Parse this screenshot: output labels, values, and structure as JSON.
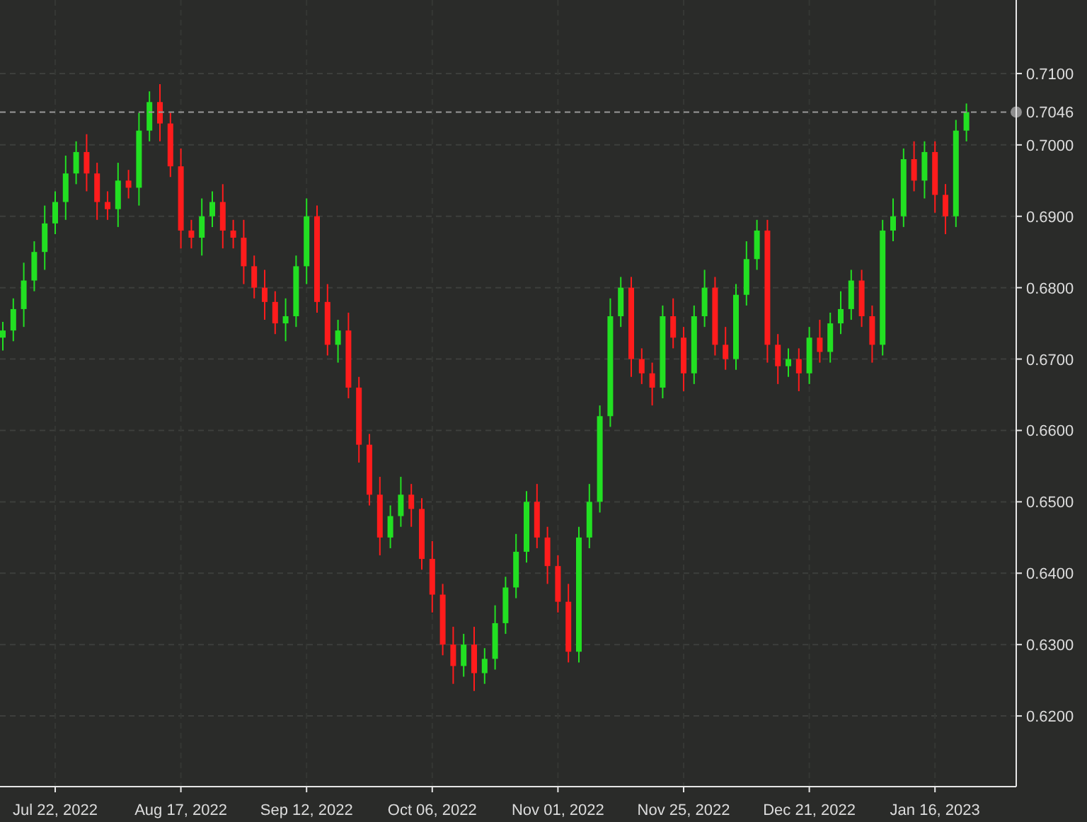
{
  "chart": {
    "chart_data": {
      "type": "candlestick",
      "grid": true,
      "ref_lines": [
        {
          "axis": "y",
          "value": 0.7046,
          "label": "0.7046"
        }
      ],
      "categories": [
        null,
        null,
        null,
        null,
        null,
        "Jul 22, 2022",
        null,
        null,
        null,
        null,
        null,
        null,
        null,
        null,
        null,
        null,
        null,
        "Aug 17, 2022",
        null,
        null,
        null,
        null,
        null,
        null,
        null,
        null,
        null,
        null,
        null,
        "Sep 12, 2022",
        null,
        null,
        null,
        null,
        null,
        null,
        null,
        null,
        null,
        null,
        null,
        "Oct 06, 2022",
        null,
        null,
        null,
        null,
        null,
        null,
        null,
        null,
        null,
        null,
        null,
        "Nov 01, 2022",
        null,
        null,
        null,
        null,
        null,
        null,
        null,
        null,
        null,
        null,
        null,
        "Nov 25, 2022",
        null,
        null,
        null,
        null,
        null,
        null,
        null,
        null,
        null,
        null,
        null,
        "Dec 21, 2022",
        null,
        null,
        null,
        null,
        null,
        null,
        null,
        null,
        null,
        null,
        null,
        "Jan 16, 2023",
        null,
        null,
        null
      ],
      "ohlc": [
        [
          0.673,
          0.6752,
          0.6712,
          0.674
        ],
        [
          0.674,
          0.6785,
          0.6725,
          0.677
        ],
        [
          0.677,
          0.6835,
          0.6745,
          0.681
        ],
        [
          0.681,
          0.6865,
          0.6795,
          0.685
        ],
        [
          0.685,
          0.6915,
          0.6825,
          0.689
        ],
        [
          0.689,
          0.6935,
          0.6875,
          0.692
        ],
        [
          0.692,
          0.6985,
          0.6895,
          0.696
        ],
        [
          0.696,
          0.7005,
          0.6945,
          0.699
        ],
        [
          0.699,
          0.7015,
          0.6935,
          0.696
        ],
        [
          0.696,
          0.6975,
          0.6895,
          0.692
        ],
        [
          0.692,
          0.6935,
          0.6895,
          0.691
        ],
        [
          0.691,
          0.6975,
          0.6885,
          0.695
        ],
        [
          0.695,
          0.6965,
          0.6925,
          0.694
        ],
        [
          0.694,
          0.7045,
          0.6915,
          0.702
        ],
        [
          0.702,
          0.7075,
          0.7005,
          0.706
        ],
        [
          0.706,
          0.7085,
          0.7005,
          0.703
        ],
        [
          0.703,
          0.7045,
          0.6955,
          0.697
        ],
        [
          0.697,
          0.6995,
          0.6855,
          0.688
        ],
        [
          0.688,
          0.6895,
          0.6855,
          0.687
        ],
        [
          0.687,
          0.6925,
          0.6845,
          0.69
        ],
        [
          0.69,
          0.6935,
          0.6885,
          0.692
        ],
        [
          0.692,
          0.6945,
          0.6855,
          0.688
        ],
        [
          0.688,
          0.6895,
          0.6855,
          0.687
        ],
        [
          0.687,
          0.6895,
          0.6805,
          0.683
        ],
        [
          0.683,
          0.6845,
          0.6785,
          0.68
        ],
        [
          0.68,
          0.6825,
          0.6755,
          0.678
        ],
        [
          0.678,
          0.6795,
          0.6735,
          0.675
        ],
        [
          0.675,
          0.6785,
          0.6725,
          0.676
        ],
        [
          0.676,
          0.6845,
          0.6745,
          0.683
        ],
        [
          0.683,
          0.6925,
          0.6805,
          0.69
        ],
        [
          0.69,
          0.6915,
          0.6765,
          0.678
        ],
        [
          0.678,
          0.6805,
          0.6705,
          0.672
        ],
        [
          0.672,
          0.6755,
          0.6695,
          0.674
        ],
        [
          0.674,
          0.6765,
          0.6645,
          0.666
        ],
        [
          0.666,
          0.6675,
          0.6555,
          0.658
        ],
        [
          0.658,
          0.6595,
          0.6495,
          0.651
        ],
        [
          0.651,
          0.6535,
          0.6425,
          0.645
        ],
        [
          0.645,
          0.6495,
          0.6435,
          0.648
        ],
        [
          0.648,
          0.6535,
          0.6465,
          0.651
        ],
        [
          0.651,
          0.6525,
          0.6465,
          0.649
        ],
        [
          0.649,
          0.6505,
          0.6405,
          0.642
        ],
        [
          0.642,
          0.6445,
          0.6345,
          0.637
        ],
        [
          0.637,
          0.6385,
          0.6285,
          0.63
        ],
        [
          0.63,
          0.6325,
          0.6245,
          0.627
        ],
        [
          0.627,
          0.6315,
          0.6255,
          0.63
        ],
        [
          0.63,
          0.6325,
          0.6235,
          0.626
        ],
        [
          0.626,
          0.6295,
          0.6245,
          0.628
        ],
        [
          0.628,
          0.6355,
          0.6265,
          0.633
        ],
        [
          0.633,
          0.6395,
          0.6315,
          0.638
        ],
        [
          0.638,
          0.6455,
          0.6365,
          0.643
        ],
        [
          0.643,
          0.6515,
          0.6415,
          0.65
        ],
        [
          0.65,
          0.6525,
          0.6435,
          0.645
        ],
        [
          0.645,
          0.6465,
          0.6385,
          0.641
        ],
        [
          0.641,
          0.6425,
          0.6345,
          0.636
        ],
        [
          0.636,
          0.6385,
          0.6275,
          0.629
        ],
        [
          0.629,
          0.6465,
          0.6275,
          0.645
        ],
        [
          0.645,
          0.6525,
          0.6435,
          0.65
        ],
        [
          0.65,
          0.6635,
          0.6485,
          0.662
        ],
        [
          0.662,
          0.6785,
          0.6605,
          0.676
        ],
        [
          0.676,
          0.6815,
          0.6745,
          0.68
        ],
        [
          0.68,
          0.6815,
          0.6675,
          0.67
        ],
        [
          0.67,
          0.6715,
          0.6665,
          0.668
        ],
        [
          0.668,
          0.6695,
          0.6635,
          0.666
        ],
        [
          0.666,
          0.6775,
          0.6645,
          0.676
        ],
        [
          0.676,
          0.6785,
          0.6715,
          0.673
        ],
        [
          0.673,
          0.6745,
          0.6655,
          0.668
        ],
        [
          0.668,
          0.6775,
          0.6665,
          0.676
        ],
        [
          0.676,
          0.6825,
          0.6745,
          0.68
        ],
        [
          0.68,
          0.6815,
          0.6705,
          0.672
        ],
        [
          0.672,
          0.6745,
          0.6685,
          0.67
        ],
        [
          0.67,
          0.6805,
          0.6685,
          0.679
        ],
        [
          0.679,
          0.6865,
          0.6775,
          0.684
        ],
        [
          0.684,
          0.6895,
          0.6825,
          0.688
        ],
        [
          0.688,
          0.6895,
          0.6695,
          0.672
        ],
        [
          0.672,
          0.6735,
          0.6665,
          0.669
        ],
        [
          0.669,
          0.6715,
          0.6675,
          0.67
        ],
        [
          0.67,
          0.6715,
          0.6655,
          0.668
        ],
        [
          0.668,
          0.6745,
          0.6665,
          0.673
        ],
        [
          0.673,
          0.6755,
          0.6695,
          0.671
        ],
        [
          0.671,
          0.6765,
          0.6695,
          0.675
        ],
        [
          0.675,
          0.6795,
          0.6735,
          0.677
        ],
        [
          0.677,
          0.6825,
          0.6755,
          0.681
        ],
        [
          0.681,
          0.6825,
          0.6745,
          0.676
        ],
        [
          0.676,
          0.6775,
          0.6695,
          0.672
        ],
        [
          0.672,
          0.6895,
          0.6705,
          0.688
        ],
        [
          0.688,
          0.6925,
          0.6865,
          0.69
        ],
        [
          0.69,
          0.6995,
          0.6885,
          0.698
        ],
        [
          0.698,
          0.7005,
          0.6935,
          0.695
        ],
        [
          0.695,
          0.7005,
          0.6925,
          0.699
        ],
        [
          0.699,
          0.7005,
          0.6905,
          0.693
        ],
        [
          0.693,
          0.6945,
          0.6875,
          0.69
        ],
        [
          0.69,
          0.7035,
          0.6885,
          0.702
        ],
        [
          0.702,
          0.7058,
          0.7005,
          0.7046
        ]
      ],
      "ylim": [
        0.6101,
        0.7203
      ],
      "yticks": [
        {
          "value": 0.71,
          "label": "0.7100"
        },
        {
          "value": 0.7,
          "label": "0.7000"
        },
        {
          "value": 0.69,
          "label": "0.6900"
        },
        {
          "value": 0.68,
          "label": "0.6800"
        },
        {
          "value": 0.67,
          "label": "0.6700"
        },
        {
          "value": 0.66,
          "label": "0.6600"
        },
        {
          "value": 0.65,
          "label": "0.6500"
        },
        {
          "value": 0.64,
          "label": "0.6400"
        },
        {
          "value": 0.63,
          "label": "0.6300"
        },
        {
          "value": 0.62,
          "label": "0.6200"
        }
      ]
    }
  }
}
